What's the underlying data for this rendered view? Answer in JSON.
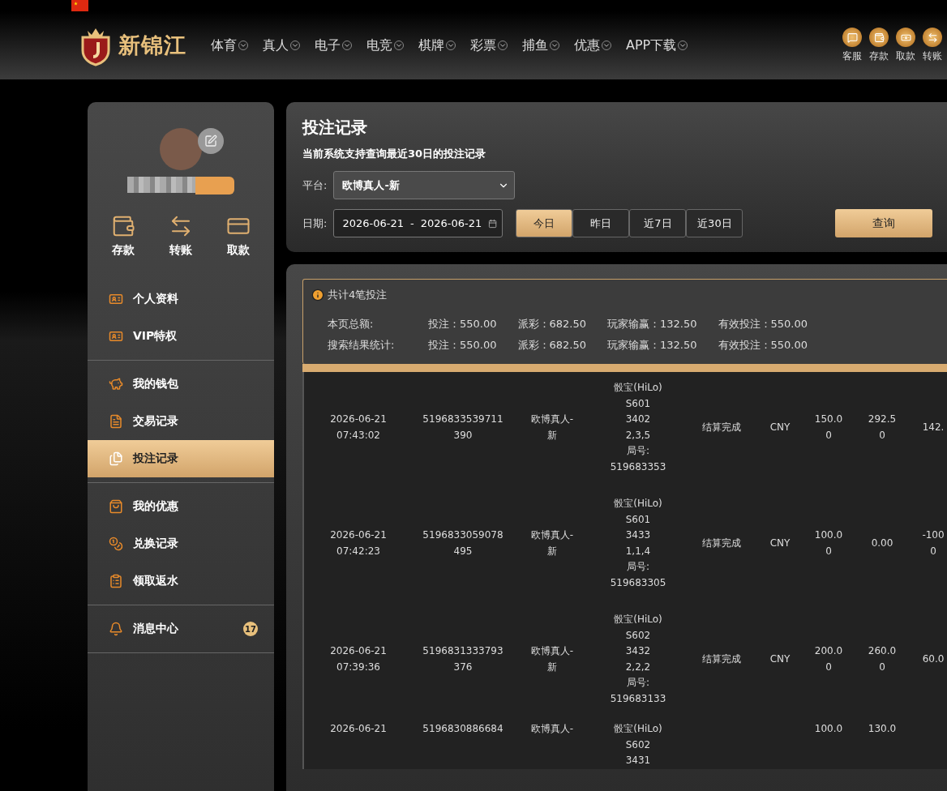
{
  "brand": {
    "name": "新锦江"
  },
  "nav": [
    {
      "label": "体育"
    },
    {
      "label": "真人"
    },
    {
      "label": "电子"
    },
    {
      "label": "电竞"
    },
    {
      "label": "棋牌"
    },
    {
      "label": "彩票"
    },
    {
      "label": "捕鱼"
    },
    {
      "label": "优惠"
    },
    {
      "label": "APP下载"
    }
  ],
  "quick_links": [
    {
      "label": "客服",
      "kind": "chat"
    },
    {
      "label": "存款",
      "kind": "wallet"
    },
    {
      "label": "取款",
      "kind": "cash"
    },
    {
      "label": "转账",
      "kind": "transfer"
    }
  ],
  "sidebar": {
    "actions": [
      {
        "label": "存款",
        "kind": "wallet"
      },
      {
        "label": "转账",
        "kind": "transfer"
      },
      {
        "label": "取款",
        "kind": "card"
      }
    ],
    "groups": [
      [
        {
          "label": "个人资料",
          "kind": "idcard",
          "selected": false
        },
        {
          "label": "VIP特权",
          "kind": "idcard",
          "selected": false
        }
      ],
      [
        {
          "label": "我的钱包",
          "kind": "piggy",
          "selected": false
        },
        {
          "label": "交易记录",
          "kind": "doc",
          "selected": false
        },
        {
          "label": "投注记录",
          "kind": "docs",
          "selected": true
        }
      ],
      [
        {
          "label": "我的优惠",
          "kind": "bag",
          "selected": false
        },
        {
          "label": "兑换记录",
          "kind": "moneybag",
          "selected": false
        },
        {
          "label": "领取返水",
          "kind": "list",
          "selected": false
        }
      ],
      [
        {
          "label": "消息中心",
          "kind": "bell",
          "selected": false,
          "badge": "17"
        }
      ]
    ]
  },
  "filter": {
    "title": "投注记录",
    "note": "当前系统支持查询最近30日的投注记录",
    "platform_label": "平台:",
    "platform_value": "欧博真人-新",
    "date_label": "日期:",
    "date_start": "2026-06-21",
    "date_separator": "-",
    "date_end": "2026-06-21",
    "ranges": [
      {
        "label": "今日",
        "selected": true
      },
      {
        "label": "昨日",
        "selected": false
      },
      {
        "label": "近7日",
        "selected": false
      },
      {
        "label": "近30日",
        "selected": false
      }
    ],
    "query_button": "查询"
  },
  "summary": {
    "count_text": "共计4笔投注",
    "rows": [
      {
        "label": "本页总额:",
        "values": [
          "投注：550.00",
          "派彩：682.50",
          "玩家输赢：132.50",
          "有效投注：550.00"
        ]
      },
      {
        "label": "搜索结果统计:",
        "values": [
          "投注：550.00",
          "派彩：682.50",
          "玩家输赢：132.50",
          "有效投注：550.00"
        ]
      }
    ]
  },
  "table": {
    "rows": [
      {
        "cells": [
          "2026-06-21\n07:43:02",
          "5196833539711\n390",
          "欧博真人-\n新",
          "骰宝(HiLo)\nS601\n3402\n2,3,5\n局号:\n519683353",
          "结算完成",
          "CNY",
          "150.0\n0",
          "292.5\n0",
          "142."
        ]
      },
      {
        "cells": [
          "2026-06-21\n07:42:23",
          "5196833059078\n495",
          "欧博真人-\n新",
          "骰宝(HiLo)\nS601\n3433\n1,1,4\n局号:\n519683305",
          "结算完成",
          "CNY",
          "100.0\n0",
          "0.00",
          "-100\n0"
        ]
      },
      {
        "cells": [
          "2026-06-21\n07:39:36",
          "5196831333793\n376",
          "欧博真人-\n新",
          "骰宝(HiLo)\nS602\n3432\n2,2,2\n局号:\n519683133",
          "结算完成",
          "CNY",
          "200.0\n0",
          "260.0\n0",
          "60.0"
        ]
      },
      {
        "cells": [
          "2026-06-21",
          "5196830886684",
          "欧博真人-",
          "骰宝(HiLo)\nS602\n3431",
          "",
          "",
          "100.0",
          "130.0",
          ""
        ]
      }
    ]
  }
}
